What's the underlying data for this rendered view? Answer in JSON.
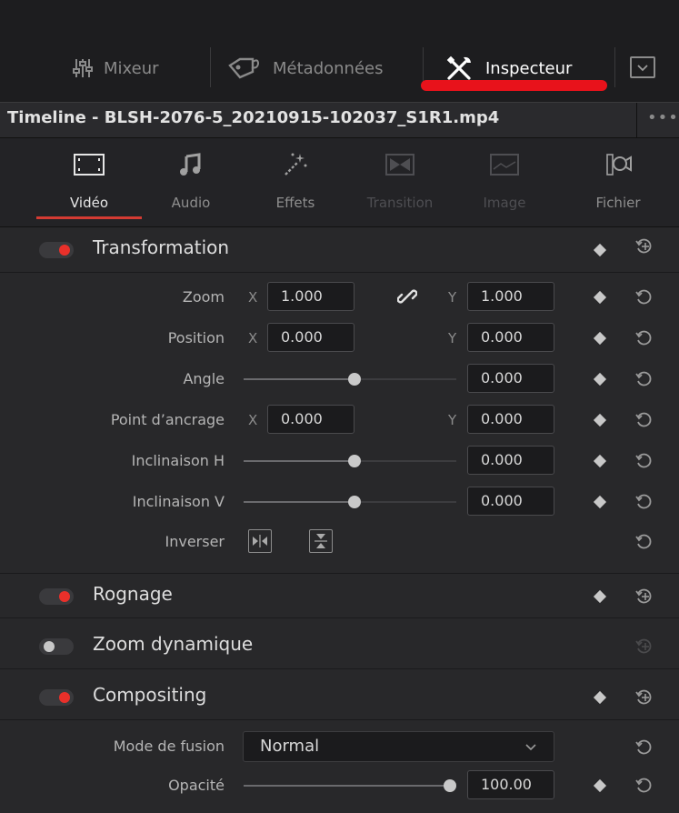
{
  "top_tabs": [
    {
      "label": "Mixeur",
      "icon": "mixer-sliders-icon"
    },
    {
      "label": "Métadonnées",
      "icon": "metadata-tag-icon"
    },
    {
      "label": "Inspecteur",
      "icon": "inspector-tools-icon",
      "active": true
    }
  ],
  "timeline_title": "Timeline - BLSH-2076-5_20210915-102037_S1R1.mp4",
  "more_label": "•••",
  "sub_tabs": [
    {
      "label": "Vidéo",
      "icon": "film-strip-icon",
      "state": "active"
    },
    {
      "label": "Audio",
      "icon": "music-note-icon",
      "state": "normal"
    },
    {
      "label": "Effets",
      "icon": "magic-wand-icon",
      "state": "normal"
    },
    {
      "label": "Transition",
      "icon": "transition-icon",
      "state": "disabled"
    },
    {
      "label": "Image",
      "icon": "image-icon",
      "state": "disabled"
    },
    {
      "label": "Fichier",
      "icon": "file-camera-icon",
      "state": "normal"
    }
  ],
  "transformation": {
    "title": "Transformation",
    "zoom": {
      "label": "Zoom",
      "x_axis": "X",
      "x": "1.000",
      "y_axis": "Y",
      "y": "1.000"
    },
    "position": {
      "label": "Position",
      "x_axis": "X",
      "x": "0.000",
      "y_axis": "Y",
      "y": "0.000"
    },
    "angle": {
      "label": "Angle",
      "value": "0.000"
    },
    "anchor": {
      "label": "Point d’ancrage",
      "x_axis": "X",
      "x": "0.000",
      "y_axis": "Y",
      "y": "0.000"
    },
    "pitch": {
      "label": "Inclinaison H",
      "value": "0.000"
    },
    "yaw": {
      "label": "Inclinaison V",
      "value": "0.000"
    },
    "flip": {
      "label": "Inverser"
    }
  },
  "cropping": {
    "title": "Rognage"
  },
  "dynamic_zoom": {
    "title": "Zoom dynamique"
  },
  "compositing": {
    "title": "Compositing",
    "blend": {
      "label": "Mode de fusion",
      "value": "Normal"
    },
    "opacity": {
      "label": "Opacité",
      "value": "100.00",
      "level": 1.0
    }
  },
  "colors": {
    "accent": "#e9302a",
    "panel": "#28282a",
    "underline": "#e8121b"
  }
}
